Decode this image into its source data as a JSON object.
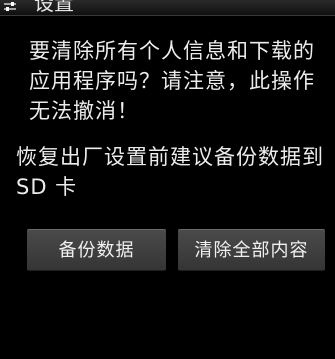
{
  "header": {
    "title": "设置",
    "icon": "settings-sliders-icon"
  },
  "warning_lines": [
    "要清除所有个人信息和下载的",
    "应用程序吗？请注意，此操作",
    "无法撤消！"
  ],
  "backup_note_lines": [
    "恢复出厂设置前建议备份数据到",
    "SD 卡"
  ],
  "buttons": {
    "backup_label": "备份数据",
    "erase_label": "清除全部内容"
  },
  "colors": {
    "background": "#000000",
    "text": "#ececec",
    "button": "#3f3f3f"
  }
}
